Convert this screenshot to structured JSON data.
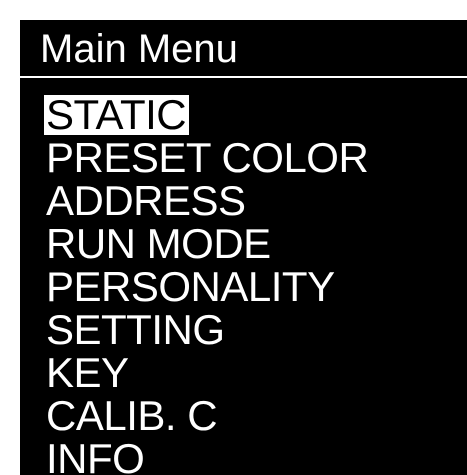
{
  "header": {
    "title": "Main Menu"
  },
  "menu": {
    "selected_index": 0,
    "items": [
      {
        "label": "STATIC"
      },
      {
        "label": "PRESET COLOR"
      },
      {
        "label": "ADDRESS"
      },
      {
        "label": "RUN MODE"
      },
      {
        "label": "PERSONALITY"
      },
      {
        "label": "SETTING"
      },
      {
        "label": "KEY"
      },
      {
        "label": "CALIB. C"
      },
      {
        "label": "INFO"
      }
    ]
  },
  "colors": {
    "background": "#000000",
    "text": "#ffffff",
    "highlight": "#ffffff",
    "highlight_text": "#000000"
  }
}
